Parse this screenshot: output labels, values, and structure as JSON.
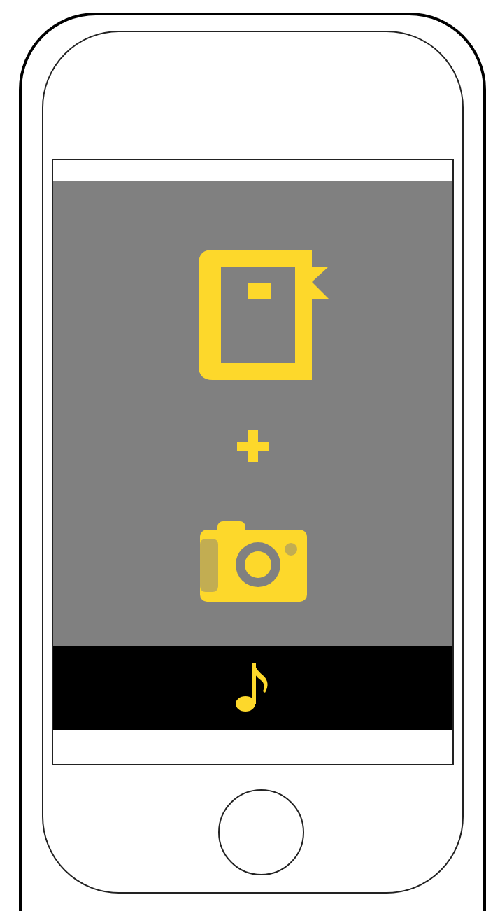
{
  "screen": {
    "items": [
      {
        "kind": "book"
      },
      {
        "kind": "plus"
      },
      {
        "kind": "camera"
      }
    ],
    "bottom_bar": {
      "kind": "note"
    }
  }
}
